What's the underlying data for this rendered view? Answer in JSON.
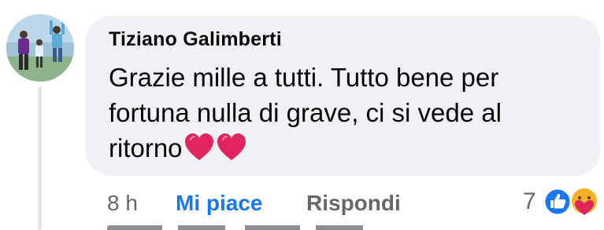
{
  "comment": {
    "author": "Tiziano Galimberti",
    "text": "Grazie mille a tutti. Tutto bene per fortuna nulla di grave, ci si vede al ritorno",
    "emojis": [
      "heart",
      "heart"
    ]
  },
  "actions": {
    "time": "8 h",
    "like_label": "Mi piace",
    "reply_label": "Rispondi"
  },
  "reactions": {
    "count": "7",
    "icons": [
      "like-icon",
      "care-icon"
    ]
  },
  "colors": {
    "bubble": "#f0f2f5",
    "like_blue": "#1877f2",
    "muted": "#65676b",
    "heart": "#e0245e"
  }
}
